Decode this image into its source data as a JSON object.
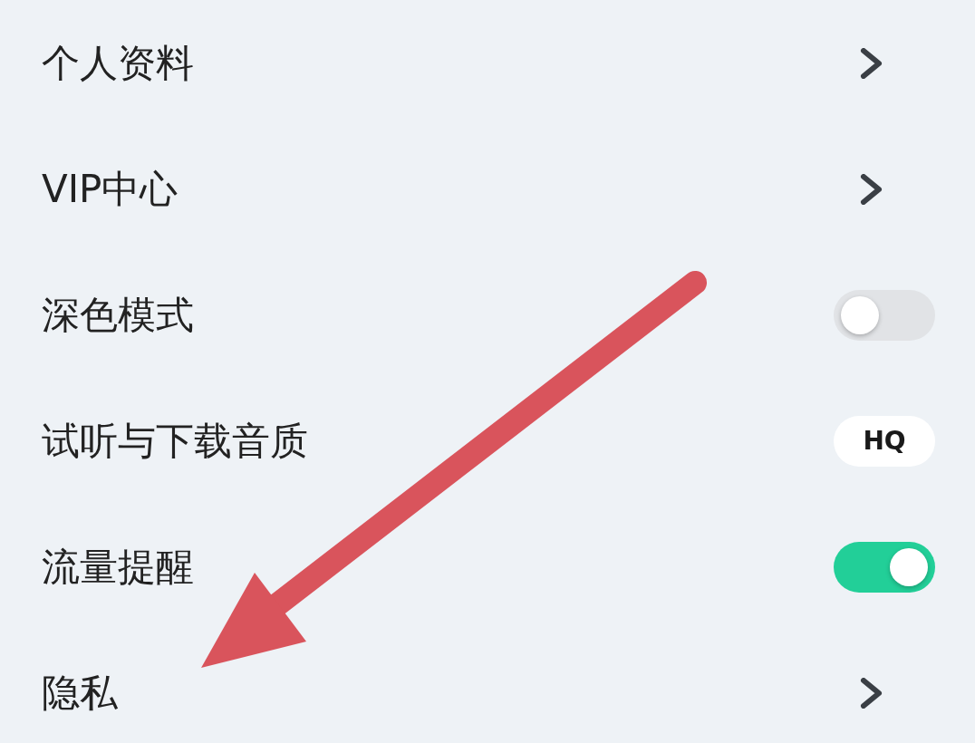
{
  "settings": [
    {
      "label": "个人资料",
      "kind": "link"
    },
    {
      "label": "VIP中心",
      "kind": "link"
    },
    {
      "label": "深色模式",
      "kind": "toggle",
      "on": false
    },
    {
      "label": "试听与下载音质",
      "kind": "badge",
      "value": "HQ"
    },
    {
      "label": "流量提醒",
      "kind": "toggle",
      "on": true
    },
    {
      "label": "隐私",
      "kind": "link"
    }
  ],
  "annotation": {
    "kind": "arrow"
  }
}
